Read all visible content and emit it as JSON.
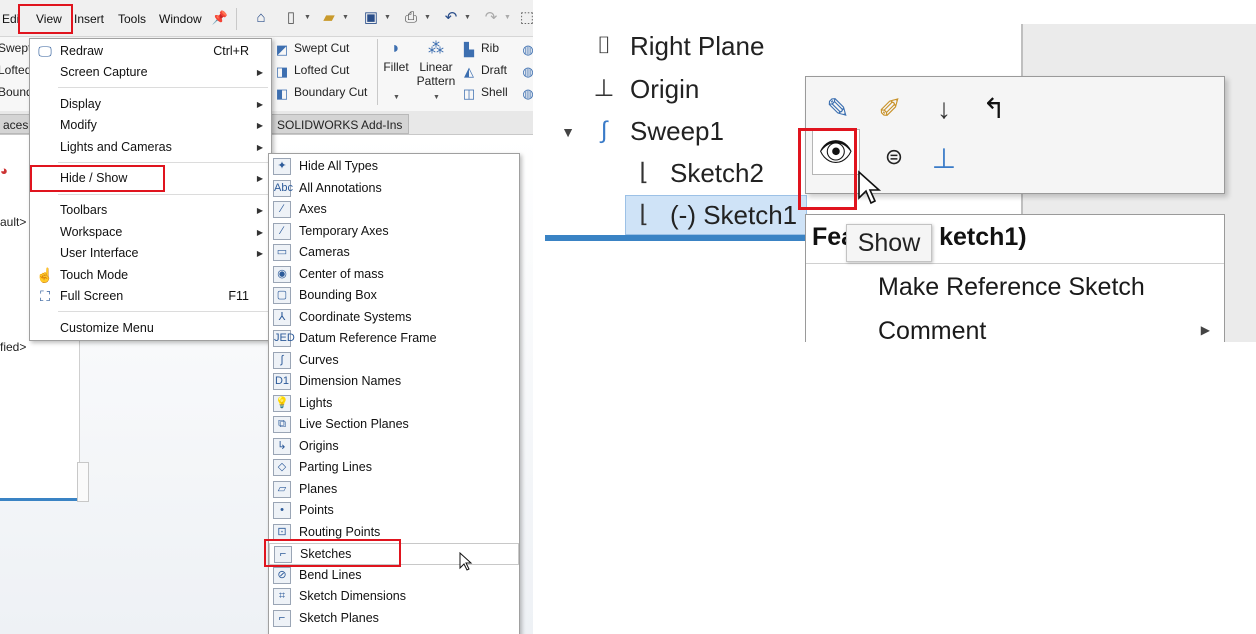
{
  "menubar": {
    "items": [
      "Edi",
      "View",
      "Insert",
      "Tools",
      "Window"
    ]
  },
  "ribbon": {
    "left_cut": [
      "Swept",
      "Lofted",
      "Bound"
    ],
    "features": [
      {
        "label": "Swept Cut",
        "icon": "swept-cut-icon"
      },
      {
        "label": "Lofted Cut",
        "icon": "lofted-cut-icon"
      },
      {
        "label": "Boundary Cut",
        "icon": "boundary-cut-icon"
      }
    ],
    "fillet": "Fillet",
    "linear_pattern": [
      "Linear",
      "Pattern"
    ],
    "right_items": [
      {
        "label": "Rib",
        "icon": "rib-icon"
      },
      {
        "label": "Draft",
        "icon": "draft-icon"
      },
      {
        "label": "Shell",
        "icon": "shell-icon"
      }
    ]
  },
  "tabs": {
    "left": "aces",
    "addins": "SOLIDWORKS Add-Ins"
  },
  "tree_fragments": {
    "default": "ault>",
    "modified": "fied>"
  },
  "view_menu": {
    "items": [
      {
        "label": "Redraw",
        "shortcut": "Ctrl+R",
        "icon": "redraw-icon"
      },
      {
        "label": "Screen Capture",
        "arrow": true
      },
      {
        "label": "Display",
        "arrow": true
      },
      {
        "label": "Modify",
        "arrow": true
      },
      {
        "label": "Lights and Cameras",
        "arrow": true
      },
      {
        "label": "Hide / Show",
        "arrow": true
      },
      {
        "label": "Toolbars",
        "arrow": true
      },
      {
        "label": "Workspace",
        "arrow": true
      },
      {
        "label": "User Interface",
        "arrow": true
      },
      {
        "label": "Touch Mode",
        "icon": "touch-icon"
      },
      {
        "label": "Full Screen",
        "shortcut": "F11",
        "icon": "fullscreen-icon"
      },
      {
        "label": "Customize Menu"
      }
    ]
  },
  "hide_show_menu": {
    "items": [
      "Hide All Types",
      "All Annotations",
      "Axes",
      "Temporary Axes",
      "Cameras",
      "Center of mass",
      "Bounding Box",
      "Coordinate Systems",
      "Datum Reference Frame",
      "Curves",
      "Dimension Names",
      "Lights",
      "Live Section Planes",
      "Origins",
      "Parting Lines",
      "Planes",
      "Points",
      "Routing Points",
      "Sketches",
      "Bend Lines",
      "Sketch Dimensions",
      "Sketch Planes"
    ],
    "icon_glyphs": [
      "✦",
      "Abc",
      "∕",
      "∕",
      "▭",
      "◉",
      "▢",
      "⅄",
      "JED",
      "∫",
      "D1",
      "💡",
      "⧉",
      "↳",
      "◇",
      "▱",
      "•",
      "⊡",
      "⌐",
      "⊘",
      "⌗",
      "⌐"
    ],
    "selected": "Sketches"
  },
  "tree_right": {
    "nodes": [
      {
        "label": "Right Plane",
        "icon": "plane-icon"
      },
      {
        "label": "Origin",
        "icon": "origin-icon"
      },
      {
        "label": "Sweep1",
        "icon": "sweep-icon"
      },
      {
        "label": "Sketch2",
        "icon": "sketch-icon"
      },
      {
        "label": "(-) Sketch1",
        "icon": "sketch-icon"
      }
    ]
  },
  "context_toolbar": {
    "icons": [
      "edit-sketch-icon",
      "edit-feature-icon",
      "rollback-icon",
      "parent-child-icon",
      "show-icon",
      "comment-icon",
      "normal-to-icon"
    ]
  },
  "context_menu": {
    "title_prefix": "Fea",
    "title_suffix": "ketch1)",
    "items": [
      "Make Reference Sketch",
      "Comment"
    ]
  },
  "tooltip": {
    "text": "Show"
  },
  "colors": {
    "highlight_red": "#e0141e",
    "selection_blue": "#cfe3f7",
    "accent_blue": "#3a83c4"
  }
}
